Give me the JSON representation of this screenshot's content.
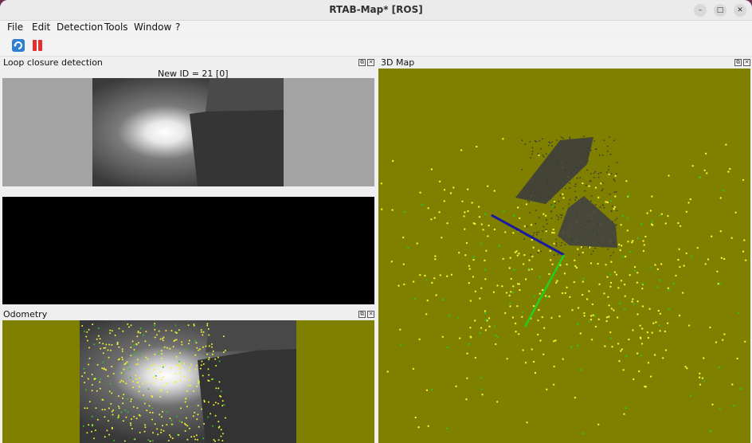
{
  "window": {
    "title": "RTAB-Map* [ROS]",
    "minimize_glyph": "–",
    "maximize_glyph": "□",
    "close_glyph": "✕"
  },
  "menu": {
    "items": [
      "File",
      "Edit",
      "Detection",
      "Tools",
      "Window",
      "?"
    ]
  },
  "toolbar": {
    "buttons": [
      {
        "name": "refresh-icon",
        "color": "#2f7fd0"
      },
      {
        "name": "pause-icon",
        "color": "#e03030"
      }
    ]
  },
  "loop_closure": {
    "title": "Loop closure detection",
    "new_id_label": "New ID = 21 [0]",
    "image_side_color": "#a3a3a3",
    "lower_view_color": "#000000"
  },
  "odometry": {
    "title": "Odometry",
    "background_color": "#808000"
  },
  "map3d": {
    "title": "3D Map",
    "background_color": "#808000",
    "axis_colors": {
      "x": "#1a1aa0",
      "y": "#20d020"
    },
    "point_colors": [
      "#f3f334",
      "#2ec02e",
      "#3a3a3a"
    ]
  },
  "dock_buttons": {
    "float_glyph": "⧉",
    "close_glyph": "✕"
  }
}
